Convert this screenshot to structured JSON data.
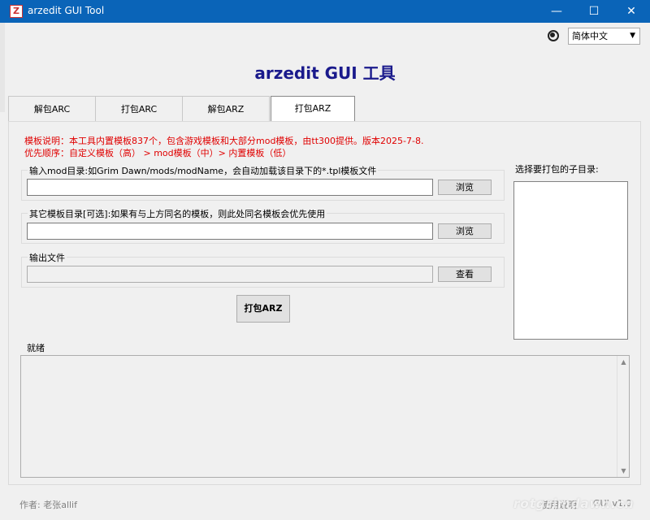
{
  "window": {
    "app_icon": "Z",
    "title": "arzedit GUI Tool",
    "minimize": "—",
    "maximize": "☐",
    "close": "✕"
  },
  "language": {
    "icon": "globe-icon",
    "selected": "简体中文"
  },
  "main_title": "arzedit GUI 工具",
  "tabs": [
    {
      "label": "解包ARC",
      "active": false
    },
    {
      "label": "打包ARC",
      "active": false
    },
    {
      "label": "解包ARZ",
      "active": false
    },
    {
      "label": "打包ARZ",
      "active": true
    }
  ],
  "notes": {
    "line1": "模板说明：本工具内置模板837个，包含游戏模板和大部分mod模板，由tt300提供。版本2025-7-8.",
    "line2": "优先顺序：自定义模板（高）  > mod模板（中）> 内置模板（低）"
  },
  "mod_dir": {
    "legend": "输入mod目录:如Grim Dawn/mods/modName，会自动加载该目录下的*.tpl模板文件",
    "value": "",
    "button": "浏览"
  },
  "template_dir": {
    "legend": "其它模板目录[可选]:如果有与上方同名的模板，则此处同名模板会优先使用",
    "value": "",
    "button": "浏览"
  },
  "output": {
    "legend": "输出文件",
    "value": "",
    "button": "查看"
  },
  "pack_button": "打包ARZ",
  "subdir_label": "选择要打包的子目录:",
  "status": "就绪",
  "footer": {
    "author": "作者: 老张allif",
    "help": "使用说明",
    "version": "GUI v1.0",
    "watermark": "rotgrimdawn.cn"
  }
}
